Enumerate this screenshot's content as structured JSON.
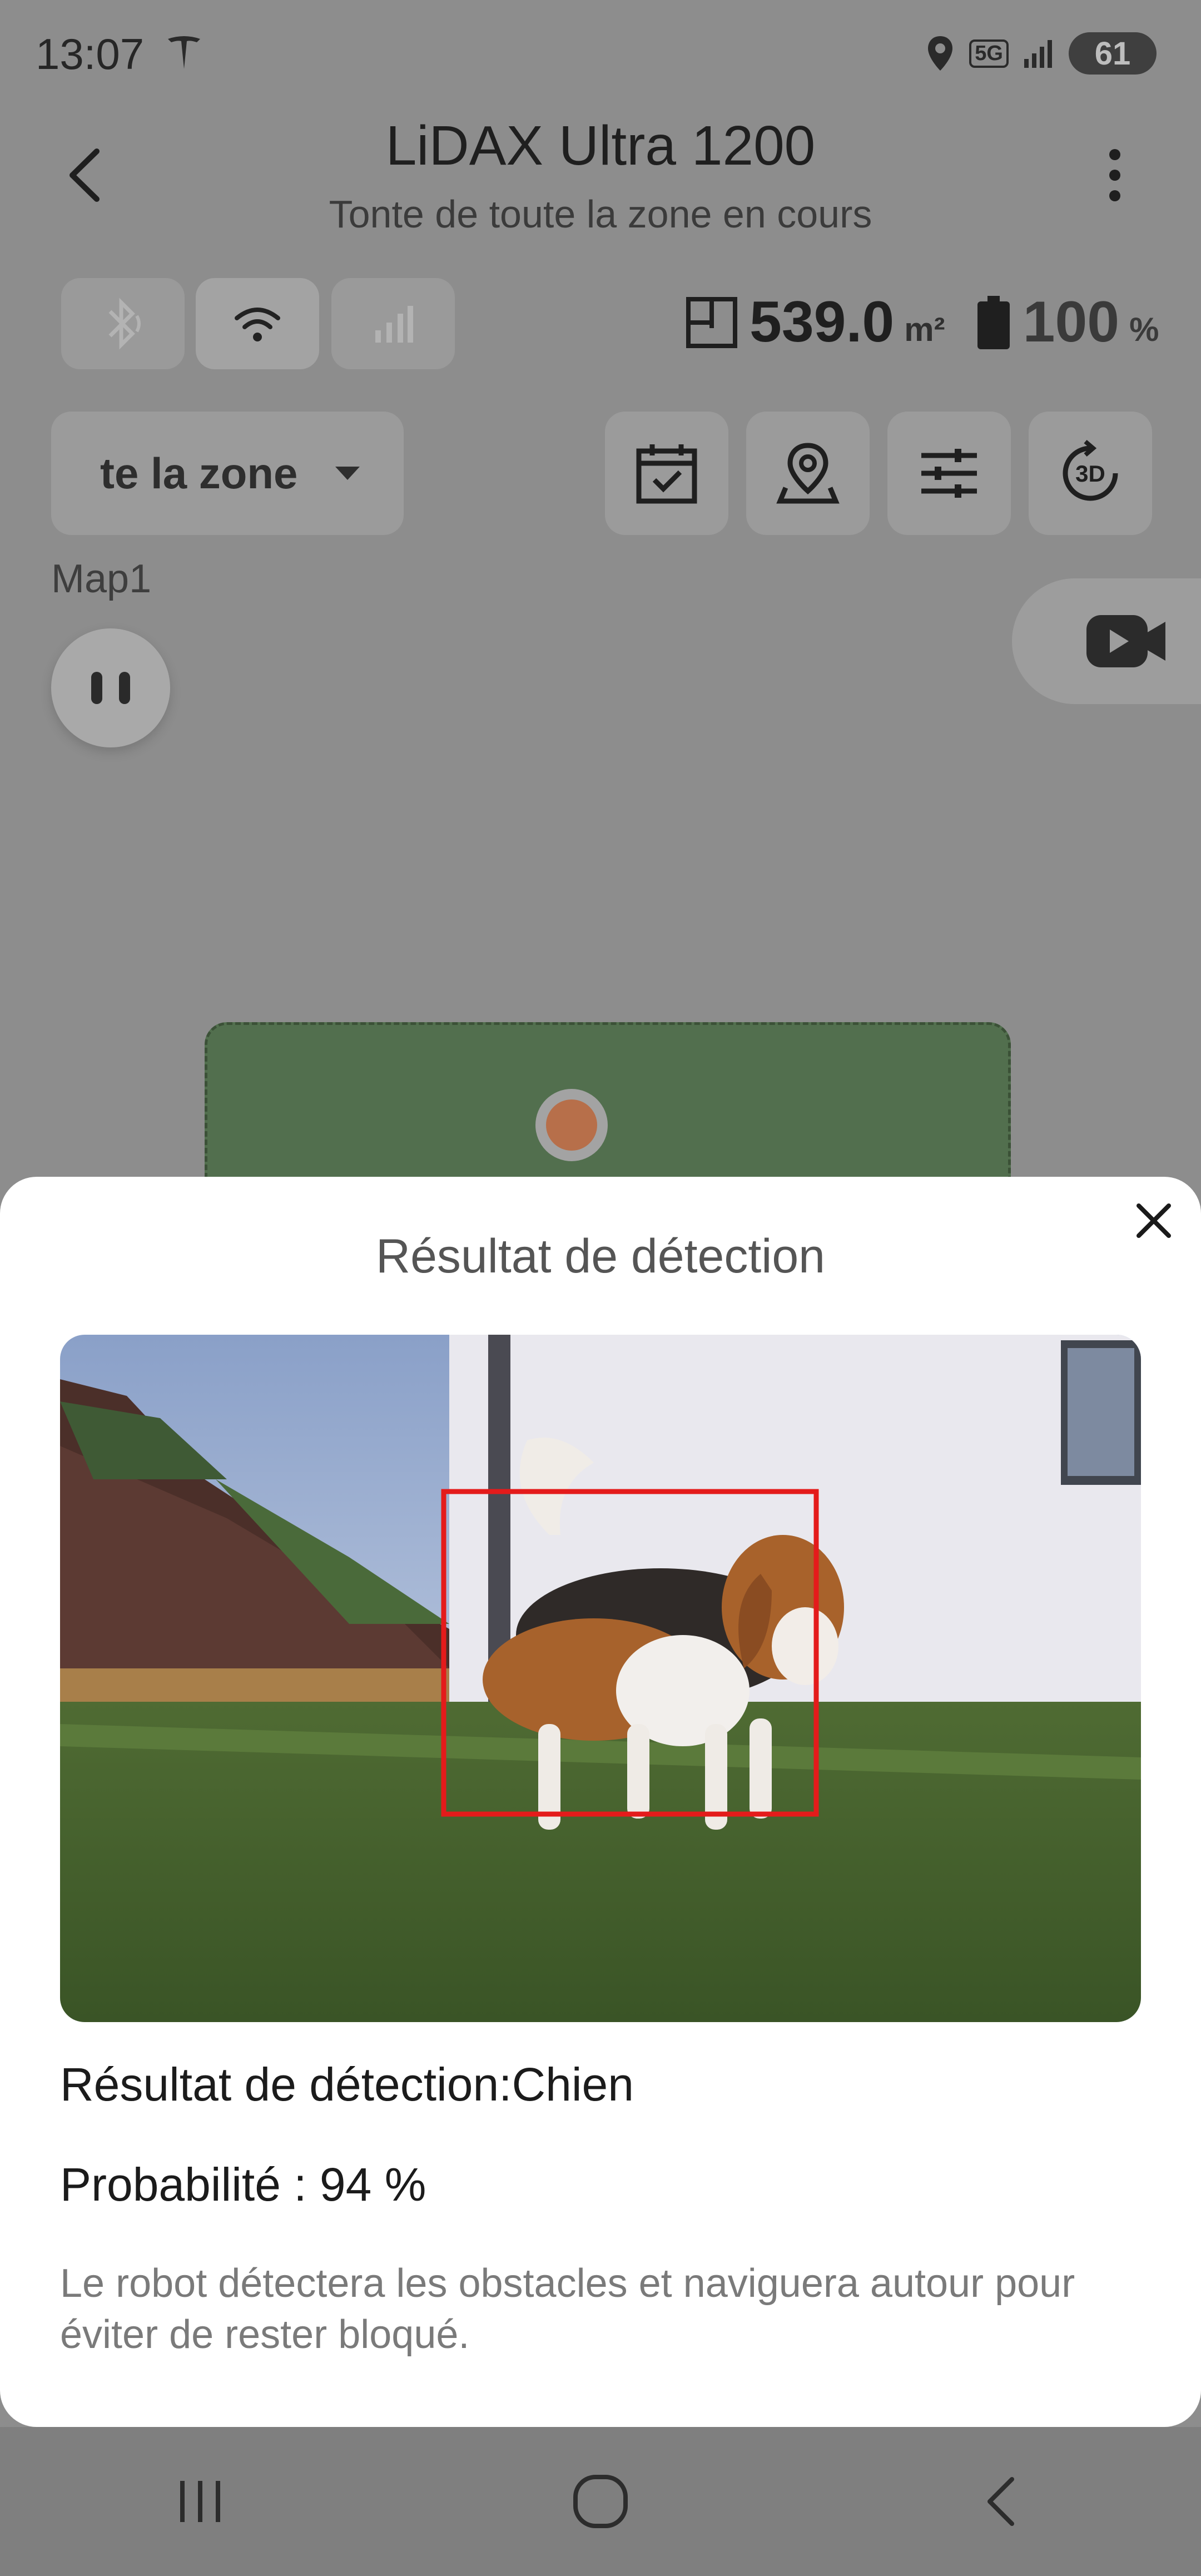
{
  "status": {
    "time": "13:07",
    "battery": "61",
    "net": "5G"
  },
  "header": {
    "title": "LiDAX Ultra 1200",
    "subtitle": "Tonte de toute la zone en cours"
  },
  "stats": {
    "area_value": "539.0",
    "area_unit": "m²",
    "battery_value": "100",
    "battery_unit": "%"
  },
  "zone_select": {
    "label": "te la zone"
  },
  "map": {
    "label": "Map1"
  },
  "sheet": {
    "title": "Résultat de détection",
    "result": "Résultat de détection:Chien",
    "probability": "Probabilité : 94 %",
    "note": "Le robot détectera les obstacles et naviguera autour pour éviter de rester bloqué."
  },
  "colors": {
    "detection_box": "#e41b1b",
    "lawn": "#526f4e",
    "overlay": "#8d8d8d"
  },
  "icons": [
    "back-icon",
    "more-icon",
    "bluetooth-icon",
    "wifi-icon",
    "cellular-icon",
    "area-icon",
    "battery-icon",
    "dropdown-icon",
    "schedule-icon",
    "location-pin-icon",
    "settings-sliders-icon",
    "3d-icon",
    "video-camera-icon",
    "close-icon",
    "recents-icon",
    "home-icon",
    "nav-back-icon"
  ]
}
